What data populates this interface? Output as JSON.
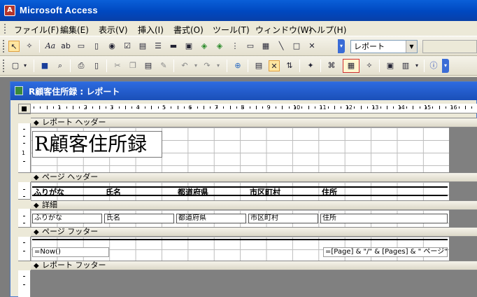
{
  "window": {
    "title": "Microsoft Access",
    "app_icon_letter": "A"
  },
  "menu": {
    "items": [
      "ファイル(F)",
      "編集(E)",
      "表示(V)",
      "挿入(I)",
      "書式(O)",
      "ツール(T)",
      "ウィンドウ(W)",
      "ヘルプ(H)"
    ]
  },
  "toolbar1": {
    "object_combo": "レポート",
    "icons": [
      "select-objects-icon",
      "control-wizards-icon",
      "label-icon",
      "textbox-icon",
      "option-group-icon",
      "toggle-button-icon",
      "option-button-icon",
      "checkbox-icon",
      "combobox-icon",
      "listbox-icon",
      "command-button-icon",
      "image-icon",
      "unbound-object-frame-icon",
      "bound-object-frame-icon",
      "page-break-icon",
      "tab-control-icon",
      "subreport-icon",
      "line-icon",
      "rectangle-icon",
      "more-controls-icon"
    ]
  },
  "toolbar2": {
    "icons": [
      "view-icon",
      "save-icon",
      "file-search-icon",
      "print-icon",
      "print-preview-icon",
      "cut-icon",
      "copy-icon",
      "paste-icon",
      "format-painter-icon",
      "undo-icon",
      "redo-icon",
      "insert-hyperlink-icon",
      "field-list-icon",
      "toolbox-icon",
      "sorting-grouping-icon",
      "autoformat-icon",
      "code-icon",
      "properties-icon",
      "build-icon",
      "database-window-icon",
      "new-object-icon",
      "help-icon"
    ]
  },
  "document": {
    "title": "R顧客住所録 : レポート"
  },
  "ruler": {
    "labels": [
      "1",
      "2",
      "3",
      "4",
      "5",
      "6",
      "7",
      "8",
      "9",
      "10",
      "11",
      "12",
      "13",
      "14",
      "15",
      "16"
    ]
  },
  "sections": {
    "report_header": "レポート ヘッダー",
    "page_header": "ページ ヘッダー",
    "detail": "詳細",
    "page_footer": "ページ フッター",
    "report_footer": "レポート フッター"
  },
  "report_title": "R顧客住所録",
  "header_labels": [
    "ふりがな",
    "氏名",
    "都道府県",
    "市区町村",
    "住所"
  ],
  "detail_fields": [
    "ふりがな",
    "氏名",
    "都道府県",
    "市区町村",
    "住所"
  ],
  "footer": {
    "date_expr": "=Now()",
    "page_expr": "=[Page] & \"/\" & [Pages] & \" ページ\""
  }
}
